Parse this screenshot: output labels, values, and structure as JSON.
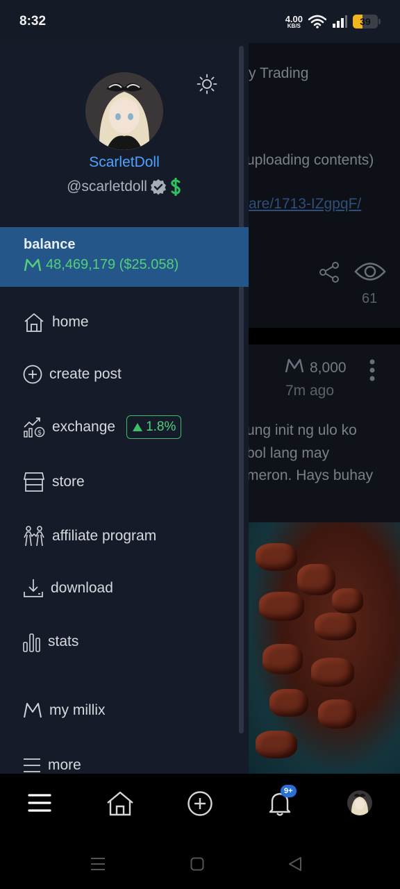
{
  "status_bar": {
    "time": "8:32",
    "net_speed_value": "4.00",
    "net_speed_unit": "KB/S",
    "battery_level": "39",
    "battery_color": "#f0b51d"
  },
  "feed": {
    "line_trading": "y Trading",
    "line_uploading": "uploading contents)",
    "line_link": "are/1713-IZgpqF/",
    "views": "61",
    "post_amount": "8,000",
    "post_time": "7m ago",
    "post_line1": "ung init ng ulo ko",
    "post_line2": "bol lang may",
    "post_line3": "meron. Hays buhay"
  },
  "drawer": {
    "theme_icon": "sun-icon",
    "display_name": "ScarletDoll",
    "handle": "@scarletdoll",
    "balance_label": "balance",
    "balance_value": "48,469,179 ($25.058)",
    "menu": {
      "home": "home",
      "create_post": "create post",
      "exchange": "exchange",
      "exchange_change": "1.8%",
      "store": "store",
      "affiliate": "affiliate program",
      "download": "download",
      "stats": "stats",
      "my_millix": "my millix",
      "more": "more"
    }
  },
  "bottom_nav": {
    "notifications_badge": "9+"
  },
  "colors": {
    "accent_blue": "#4da3ff",
    "balance_bg": "#24568a",
    "positive_green": "#52d07a",
    "drawer_bg": "#161b2a"
  }
}
